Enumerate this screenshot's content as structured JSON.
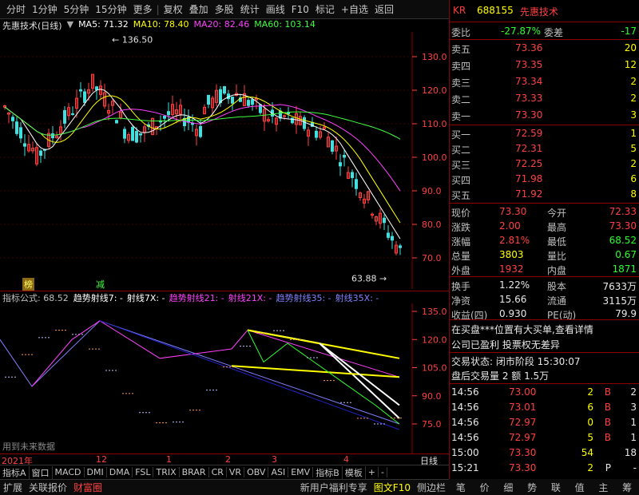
{
  "toolbar": {
    "items": [
      "分时",
      "1分钟",
      "5分钟",
      "15分钟",
      "更多",
      "复权",
      "叠加",
      "多股",
      "统计",
      "画线",
      "F10",
      "标记",
      "+自选",
      "返回"
    ]
  },
  "chart": {
    "title": "先惠技术(日线)",
    "ma": [
      {
        "label": "MA5: 71.32",
        "color": "#ffffff"
      },
      {
        "label": "MA10: 78.40",
        "color": "#ffff00"
      },
      {
        "label": "MA20: 82.46",
        "color": "#ff40ff"
      },
      {
        "label": "MA60: 103.14",
        "color": "#40ff40"
      }
    ],
    "price_axis": [
      "130.0",
      "120.0",
      "110.0",
      "100.0",
      "90.0",
      "80.0",
      "70.0"
    ],
    "high_label": "136.50",
    "low_label": "63.88",
    "marker1": "榜",
    "marker2": "减"
  },
  "indicator": {
    "name": "指标公式",
    "value": ": 68.52",
    "lines": [
      {
        "label": "趋势射线7: -",
        "color": "#ffffff"
      },
      {
        "label": "射线7X: -",
        "color": "#ffffff"
      },
      {
        "label": "趋势射线21: -",
        "color": "#ff40ff"
      },
      {
        "label": "射线21X: -",
        "color": "#ff40ff"
      },
      {
        "label": "趋势射线35: -",
        "color": "#8080ff"
      },
      {
        "label": "射线35X: -",
        "color": "#8080ff"
      }
    ],
    "axis": [
      "135.0",
      "120.0",
      "105.0",
      "90.0",
      "75.0"
    ],
    "note": "用到未来数据"
  },
  "time_axis": {
    "labels": [
      "2021年",
      "12",
      "1",
      "2",
      "3",
      "4"
    ],
    "right": "日线"
  },
  "tabs": [
    "指标A",
    "窗口",
    "MACD",
    "DMI",
    "DMA",
    "FSL",
    "TRIX",
    "BRAR",
    "CR",
    "VR",
    "OBV",
    "ASI",
    "EMV",
    "指标B",
    "模板",
    "+",
    "-"
  ],
  "bottombar": {
    "items": [
      "扩展",
      "关联报价",
      "财富圈"
    ],
    "right": [
      "新用户福利专享",
      "图文F10",
      "侧边栏"
    ]
  },
  "quote": {
    "code": "688155",
    "name": "先惠技术",
    "kr": "KR",
    "weibi_label": "委比",
    "weibi": "-27.87%",
    "weicha_label": "委差",
    "weicha": "-17",
    "asks": [
      {
        "label": "卖五",
        "price": "73.36",
        "vol": "20"
      },
      {
        "label": "卖四",
        "price": "73.35",
        "vol": "12"
      },
      {
        "label": "卖三",
        "price": "73.34",
        "vol": "2"
      },
      {
        "label": "卖二",
        "price": "73.33",
        "vol": "2"
      },
      {
        "label": "卖一",
        "price": "73.30",
        "vol": "3"
      }
    ],
    "bids": [
      {
        "label": "买一",
        "price": "72.59",
        "vol": "1"
      },
      {
        "label": "买二",
        "price": "72.31",
        "vol": "5"
      },
      {
        "label": "买三",
        "price": "72.25",
        "vol": "2"
      },
      {
        "label": "买四",
        "price": "71.98",
        "vol": "6"
      },
      {
        "label": "买五",
        "price": "71.92",
        "vol": "8"
      }
    ],
    "stats": [
      {
        "l1": "现价",
        "v1": "73.30",
        "c1": "red",
        "l2": "今开",
        "v2": "72.33",
        "c2": "red"
      },
      {
        "l1": "涨跌",
        "v1": "2.00",
        "c1": "red",
        "l2": "最高",
        "v2": "73.30",
        "c2": "red"
      },
      {
        "l1": "涨幅",
        "v1": "2.81%",
        "c1": "red",
        "l2": "最低",
        "v2": "68.52",
        "c2": "grn"
      },
      {
        "l1": "总量",
        "v1": "3803",
        "c1": "yel",
        "l2": "量比",
        "v2": "0.67",
        "c2": "grn"
      },
      {
        "l1": "外盘",
        "v1": "1932",
        "c1": "red",
        "l2": "内盘",
        "v2": "1871",
        "c2": "grn"
      }
    ],
    "stats2": [
      {
        "l1": "换手",
        "v1": "1.22%",
        "l2": "股本",
        "v2": "7633万"
      },
      {
        "l1": "净资",
        "v1": "15.66",
        "l2": "流通",
        "v2": "3115万"
      },
      {
        "l1": "收益(四)",
        "v1": "0.930",
        "l2": "PE(动)",
        "v2": "79.9"
      }
    ],
    "notice1": "在买盘***位置有大买单,查看详情",
    "notice2": "公司已盈利 投票权无差异",
    "status": "交易状态: 闭市阶段 15:30:07",
    "after": "盘后交易量 2 额 1.5万",
    "ticks": [
      {
        "t": "14:56",
        "p": "73.00",
        "v": "2",
        "s": "B",
        "n": "2"
      },
      {
        "t": "14:56",
        "p": "73.01",
        "v": "6",
        "s": "B",
        "n": "3"
      },
      {
        "t": "14:56",
        "p": "72.97",
        "v": "0",
        "s": "B",
        "n": "1"
      },
      {
        "t": "14:56",
        "p": "72.97",
        "v": "5",
        "s": "B",
        "n": "1"
      },
      {
        "t": "15:00",
        "p": "73.30",
        "v": "54",
        "s": "",
        "n": "18"
      },
      {
        "t": "15:21",
        "p": "73.30",
        "v": "2",
        "s": "P",
        "n": "-"
      }
    ]
  },
  "sidebtns": [
    "笔",
    "价",
    "细",
    "势",
    "联",
    "值",
    "主",
    "筹"
  ],
  "colors": {
    "up": "#ff4040",
    "down": "#2aff2a",
    "border": "#8b0000"
  }
}
